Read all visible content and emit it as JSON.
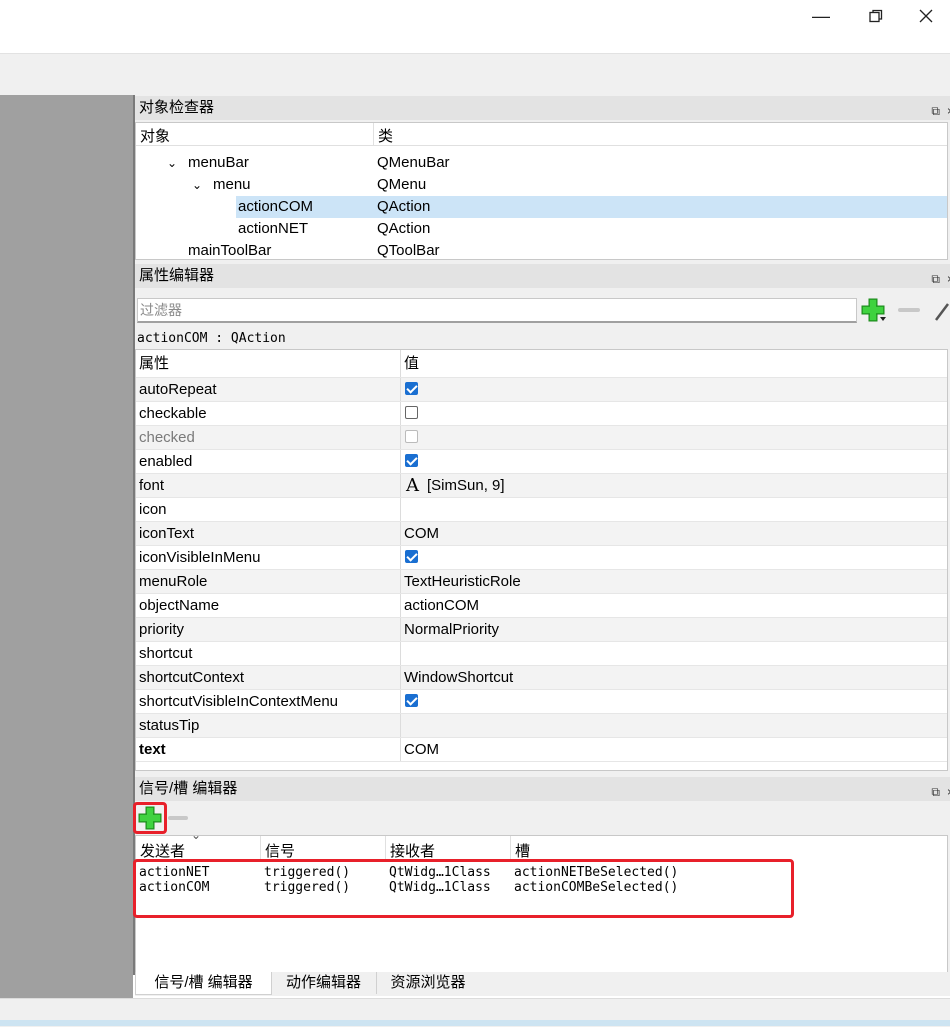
{
  "window": {
    "minimize_icon": "minimize-icon",
    "restore_icon": "restore-icon",
    "close_icon": "close-icon"
  },
  "object_inspector": {
    "title": "对象检查器",
    "headers": [
      "对象",
      "类"
    ],
    "rows": [
      {
        "name": "menuBar",
        "class": "QMenuBar"
      },
      {
        "name": "menu",
        "class": "QMenu"
      },
      {
        "name": "actionCOM",
        "class": "QAction"
      },
      {
        "name": "actionNET",
        "class": "QAction"
      },
      {
        "name": "mainToolBar",
        "class": "QToolBar"
      }
    ]
  },
  "property_editor": {
    "title": "属性编辑器",
    "filter_placeholder": "过滤器",
    "object_class": "actionCOM : QAction",
    "headers": [
      "属性",
      "值"
    ],
    "rows": [
      {
        "name": "autoRepeat",
        "value": "",
        "checkbox": "checked"
      },
      {
        "name": "checkable",
        "value": "",
        "checkbox": "unchecked"
      },
      {
        "name": "checked",
        "value": "",
        "checkbox": "disabled"
      },
      {
        "name": "enabled",
        "value": "",
        "checkbox": "checked"
      },
      {
        "name": "font",
        "value": "[SimSun, 9]",
        "font_glyph": "A"
      },
      {
        "name": "icon",
        "value": ""
      },
      {
        "name": "iconText",
        "value": "COM"
      },
      {
        "name": "iconVisibleInMenu",
        "value": "",
        "checkbox": "checked"
      },
      {
        "name": "menuRole",
        "value": "TextHeuristicRole"
      },
      {
        "name": "objectName",
        "value": "actionCOM"
      },
      {
        "name": "priority",
        "value": "NormalPriority"
      },
      {
        "name": "shortcut",
        "value": ""
      },
      {
        "name": "shortcutContext",
        "value": "WindowShortcut"
      },
      {
        "name": "shortcutVisibleInContextMenu",
        "value": "",
        "checkbox": "checked"
      },
      {
        "name": "statusTip",
        "value": ""
      },
      {
        "name": "text",
        "value": "COM"
      }
    ]
  },
  "signal_slot_editor": {
    "title": "信号/槽 编辑器",
    "headers": [
      "发送者",
      "信号",
      "接收者",
      "槽"
    ],
    "rows": [
      {
        "sender": "actionNET",
        "signal": "triggered()",
        "receiver": "QtWidg…1Class",
        "slot": "actionNETBeSelected()"
      },
      {
        "sender": "actionCOM",
        "signal": "triggered()",
        "receiver": "QtWidg…1Class",
        "slot": "actionCOMBeSelected()"
      }
    ]
  },
  "tabs": [
    "信号/槽 编辑器",
    "动作编辑器",
    "资源浏览器"
  ],
  "colors": {
    "selection": "#cce4f7",
    "checkbox": "#1a6fd1",
    "highlight": "#e8202a",
    "plus": "#2fb62f"
  }
}
